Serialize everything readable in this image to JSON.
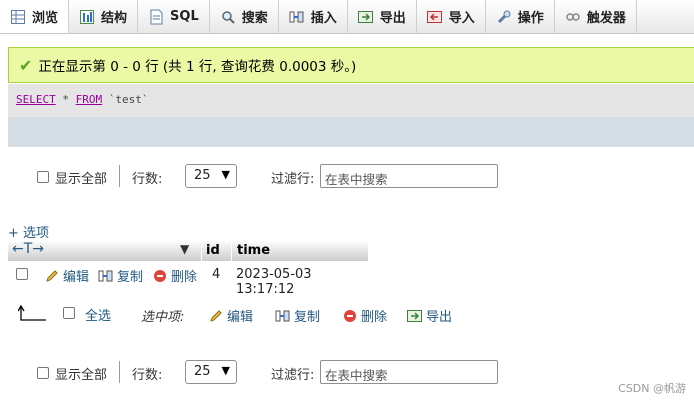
{
  "tabs": [
    {
      "label": "浏览",
      "icon": "browse-icon"
    },
    {
      "label": "结构",
      "icon": "structure-icon"
    },
    {
      "label": "SQL",
      "icon": "sql-icon"
    },
    {
      "label": "搜索",
      "icon": "search-icon"
    },
    {
      "label": "插入",
      "icon": "insert-icon"
    },
    {
      "label": "导出",
      "icon": "export-icon"
    },
    {
      "label": "导入",
      "icon": "import-icon"
    },
    {
      "label": "操作",
      "icon": "wrench-icon"
    },
    {
      "label": "触发器",
      "icon": "trigger-icon"
    }
  ],
  "message": "正在显示第 0 - 0 行 (共 1 行, 查询花费 0.0003 秒。)",
  "sql": {
    "kw1": "SELECT",
    "star": " * ",
    "kw2": "FROM",
    "table": " `test`"
  },
  "nav": {
    "show_all": "显示全部",
    "rows_label": "行数:",
    "rows_value": "25",
    "filter_label": "过滤行:",
    "filter_placeholder": "在表中搜索"
  },
  "options_link": "+ 选项",
  "table": {
    "columns": [
      "id",
      "time"
    ],
    "rows": [
      {
        "edit": "编辑",
        "copy": "复制",
        "delete": "删除",
        "id": "4",
        "time": "2023-05-03 13:17:12"
      }
    ]
  },
  "bulk": {
    "select_all": "全选",
    "with_selected": "选中项:",
    "edit": "编辑",
    "copy": "复制",
    "delete": "删除",
    "export": "导出"
  },
  "watermark": "CSDN @帆游",
  "colors": {
    "success_bg": "#ebf8a4",
    "link": "#235a81",
    "keyword": "#990099"
  }
}
